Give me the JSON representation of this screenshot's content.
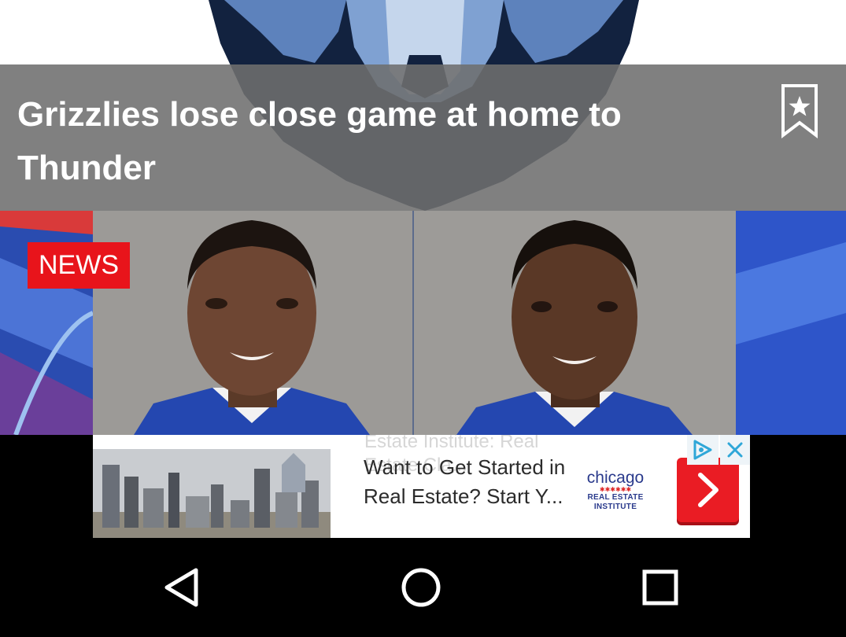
{
  "hero_story": {
    "headline": "Grizzlies lose close game at home to Thunder",
    "bookmark_icon": "bookmark-star-icon"
  },
  "news_story": {
    "badge": "NEWS"
  },
  "ad": {
    "ghost_text": "Estate Institute: Real Estate Cla...",
    "text": "Want to Get Started in Real Estate? Start Y...",
    "logo_top": "chicago",
    "logo_bottom": "REAL ESTATE INSTITUTE",
    "cta_icon": "chevron-right-icon",
    "choices_icon": "ad-choices-icon",
    "close_icon": "close-icon",
    "accent_color": "#ea1c24"
  },
  "navigation": {
    "back_icon": "back-triangle-icon",
    "home_icon": "home-circle-icon",
    "recents_icon": "recents-square-icon"
  },
  "colors": {
    "overlay": "#6e6e6e",
    "badge": "#e8141b",
    "grizzlies_navy": "#12223f",
    "grizzlies_blue": "#5d82bc"
  }
}
